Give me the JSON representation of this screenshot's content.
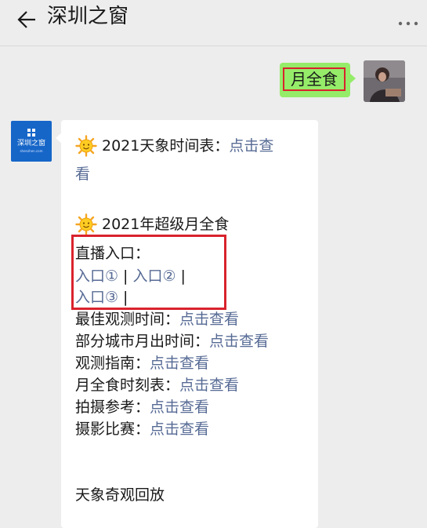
{
  "header": {
    "title": "深圳之窗"
  },
  "bot_avatar": {
    "logo_text": "深圳之窗",
    "logo_sub": "shenzhen.com"
  },
  "outgoing": {
    "text": "月全食"
  },
  "incoming": {
    "schedule": {
      "label": "2021天象时间表：",
      "link_a": "点击查",
      "link_b": "看"
    },
    "eclipse_title": "2021年超级月全食",
    "live_label": "直播入口：",
    "entry1": "入口①",
    "entry2": "入口②",
    "entry3": "入口③",
    "separator": "|",
    "items": [
      {
        "label": "最佳观测时间：",
        "link": "点击查看"
      },
      {
        "label": "部分城市月出时间：",
        "link": "点击查看"
      },
      {
        "label": "观测指南：",
        "link": "点击查看"
      },
      {
        "label": "月全食时刻表：",
        "link": "点击查看"
      },
      {
        "label": "拍摄参考：",
        "link": "点击查看"
      },
      {
        "label": "摄影比赛：",
        "link": "点击查看"
      }
    ],
    "replay": "天象奇观回放"
  },
  "colors": {
    "link": "#576b95",
    "bubble_out": "#95ec69",
    "highlight": "#d9232d",
    "brand": "#1666c8"
  }
}
